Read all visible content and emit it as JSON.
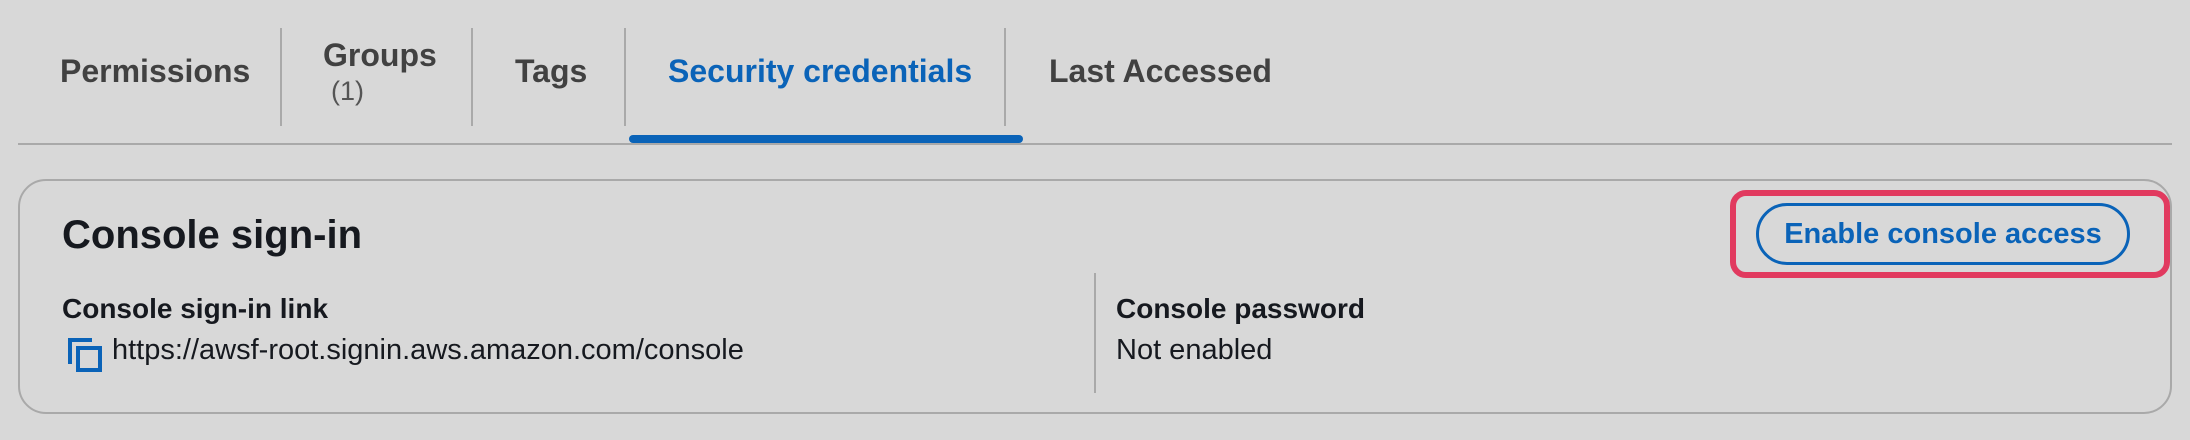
{
  "tabs": [
    {
      "label": "Permissions"
    },
    {
      "label": "Groups",
      "count": "(1)"
    },
    {
      "label": "Tags"
    },
    {
      "label": "Security credentials",
      "active": true
    },
    {
      "label": "Last Accessed"
    }
  ],
  "console_signin": {
    "title": "Console sign-in",
    "enable_button_label": "Enable console access",
    "signin_link_label": "Console sign-in link",
    "signin_link_value": "https://awsf-root.signin.aws.amazon.com/console",
    "password_label": "Console password",
    "password_value": "Not enabled",
    "copy_icon": "copy-icon"
  },
  "colors": {
    "accent": "#0a63b8",
    "highlight": "#e13a5f",
    "background": "#d8d8d8"
  }
}
